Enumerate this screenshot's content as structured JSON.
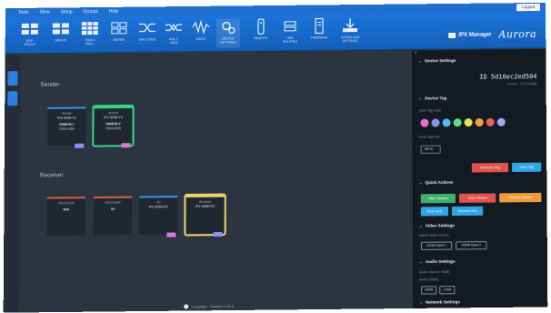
{
  "menu": [
    "Tools",
    "View",
    "Setup",
    "Groups",
    "Help"
  ],
  "logout_label": "Logout",
  "toolbar": [
    {
      "icon": "add-group-icon",
      "label": "ADD\nGROUP"
    },
    {
      "icon": "group-icon",
      "label": "GROUP"
    },
    {
      "icon": "video-wall-icon",
      "label": "VIDEO\nWALL"
    },
    {
      "icon": "matrix-icon",
      "label": "MATRIX"
    },
    {
      "icon": "switcher-icon",
      "label": "SWITCHER"
    },
    {
      "icon": "multiview-icon",
      "label": "MULTI\nVIEW"
    },
    {
      "icon": "audio-waveform-icon",
      "label": "AUDIO"
    },
    {
      "icon": "device-settings-icon",
      "label": "DEVICE\nSETTINGS"
    },
    {
      "icon": "remote-icon",
      "label": "REMOTE"
    },
    {
      "icon": "usb-icon",
      "label": "USB\nROUTING"
    },
    {
      "icon": "firmware-icon",
      "label": "FIRMWARE"
    },
    {
      "icon": "download-icon",
      "label": "DOWNLOAD\nSETTINGS"
    }
  ],
  "brand": {
    "product": "IPX Manager",
    "logo": "Aurora"
  },
  "main": {
    "sender_title": "Sender",
    "receiver_title": "Receiver",
    "senders": [
      {
        "line1": "Sender",
        "line2": "IPX-HDMI-TX",
        "line3": "HDMI-IN-1",
        "line4": "1920x1080",
        "tag_color": "#8b8ff2"
      },
      {
        "line1": "Sender",
        "line2": "IPX-HDMI-TX",
        "line3": "HDMI-IN-2",
        "line4": "1920x1080",
        "tag_color": "#d57be0"
      }
    ],
    "receivers": [
      {
        "line1": "RECEIVER",
        "line2": "OFF",
        "line3": "",
        "line4": "",
        "tag_color": ""
      },
      {
        "line1": "RECEIVER",
        "line2": "IN",
        "line3": "",
        "line4": "",
        "tag_color": ""
      },
      {
        "line1": "Rx",
        "line2": "IPX-HDMI-RX",
        "line3": "",
        "line4": "",
        "tag_color": "#d57be0"
      },
      {
        "line1": "Receiver",
        "line2": "IPX-HDMI-RX",
        "line3": "",
        "line4": "",
        "tag_color": "#8b8ff2"
      }
    ],
    "footer": "Copyright · Version 1.20.3"
  },
  "panel": {
    "device_settings_title": "Device Settings",
    "device_id": "ID 5d10ec2ed504",
    "device_sub": "Sender · 4.1023a96b",
    "device_tag_title": "Device Tag",
    "color_tag_label": "Color Tag Color",
    "swatch_colors": [
      "#e26fd6",
      "#8b8ff2",
      "#54b9f2",
      "#5fe08a",
      "#dce94f",
      "#f2a04a",
      "#f25c5c",
      "#a7a7f7"
    ],
    "text_tag_label": "Enter Tag Text",
    "text_tag_value": "ABCD",
    "remove_tag": "Remove Tag",
    "save_tag": "Save Tag",
    "quick_actions_title": "Quick Actions",
    "quick_actions": [
      {
        "label": "Start Stream",
        "color": "#3fb06a"
      },
      {
        "label": "Stop Stream",
        "color": "#e0534d"
      },
      {
        "label": "Reboot Device",
        "color": "#f29a3a"
      },
      {
        "label": "Blink LED",
        "color": "#2ea6e8"
      },
      {
        "label": "Normal LED",
        "color": "#2ea6e8"
      }
    ],
    "video_settings_title": "Video Settings",
    "video_source_label": "Select Video Source",
    "video_sources": [
      "HDMI Input 1",
      "HDMI Input 2"
    ],
    "audio_settings_title": "Audio Settings",
    "audio_source_label": "Audio Source: HDMI",
    "audio_output_label": "Audio Output",
    "audio_outputs": [
      "HDMI",
      "Local"
    ],
    "network_settings_title": "Network Settings"
  }
}
